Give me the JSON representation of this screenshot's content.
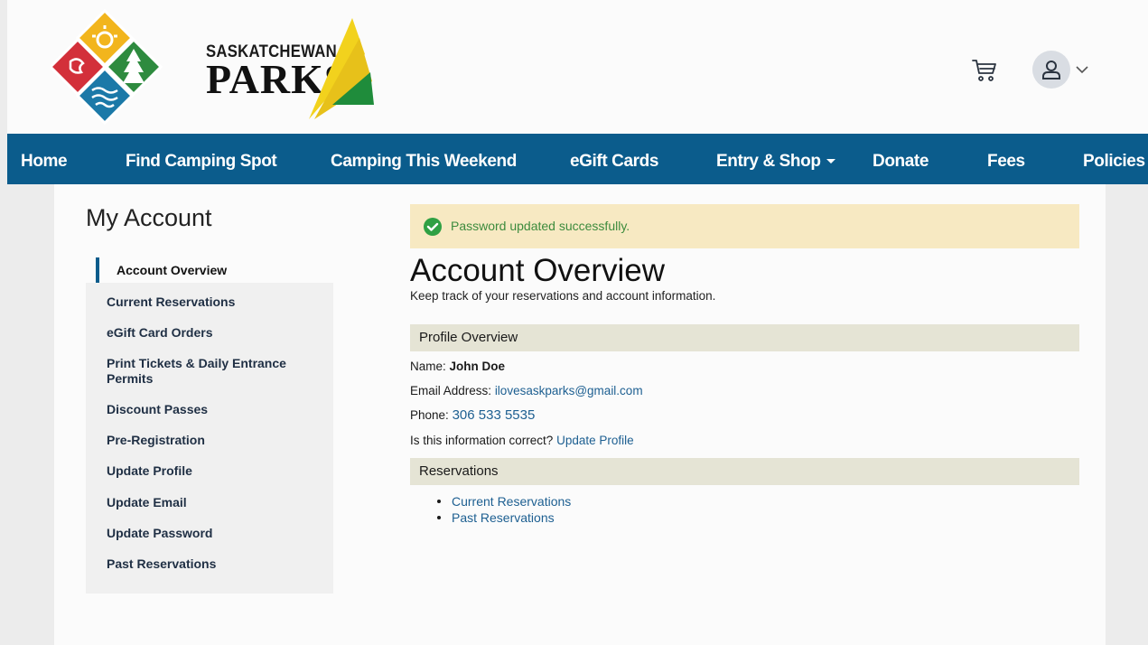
{
  "header": {
    "logo": {
      "line1": "SASKATCHEWAN",
      "line2": "PARKS"
    },
    "icons": {
      "cart": "shopping-cart-icon",
      "user": "user-icon",
      "chevron": "chevron-down-icon"
    }
  },
  "nav": {
    "items": [
      {
        "label": "Home"
      },
      {
        "label": "Find Camping Spot"
      },
      {
        "label": "Camping This Weekend"
      },
      {
        "label": "eGift Cards"
      },
      {
        "label": "Entry & Shop",
        "has_dropdown": true
      },
      {
        "label": "Donate"
      },
      {
        "label": "Fees"
      },
      {
        "label": "Policies"
      }
    ]
  },
  "sidebar": {
    "title": "My Account",
    "items": [
      {
        "label": "Account Overview",
        "active": true
      },
      {
        "label": "Current Reservations"
      },
      {
        "label": "eGift Card Orders"
      },
      {
        "label": "Print Tickets & Daily Entrance Permits"
      },
      {
        "label": "Discount Passes"
      },
      {
        "label": "Pre-Registration"
      },
      {
        "label": "Update Profile"
      },
      {
        "label": "Update Email"
      },
      {
        "label": "Update Password"
      },
      {
        "label": "Past Reservations"
      }
    ]
  },
  "alert": {
    "message": "Password updated successfully.",
    "icon": "check-circle-icon",
    "color": "#3d8b3d"
  },
  "main": {
    "title": "Account Overview",
    "subtitle": "Keep track of your reservations and account information.",
    "profile": {
      "section_title": "Profile Overview",
      "name_label": "Name:",
      "name_value": "John Doe",
      "email_label": "Email Address:",
      "email_value": "ilovesaskparks@gmail.com",
      "phone_label": "Phone:",
      "phone_value": "306 533 5535",
      "confirm_question": "Is this information correct?",
      "update_link": "Update Profile"
    },
    "reservations": {
      "section_title": "Reservations",
      "links": [
        "Current Reservations",
        "Past Reservations"
      ]
    }
  },
  "colors": {
    "nav_bg": "#0b5c8c",
    "link": "#1d5f91",
    "alert_bg": "#f7e9c2",
    "section_bg": "#e5e4d5"
  }
}
